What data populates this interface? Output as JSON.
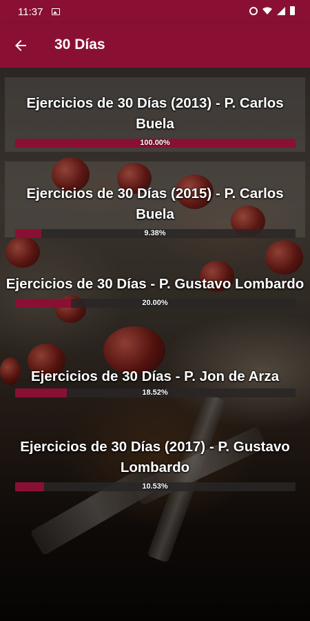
{
  "status_bar": {
    "time": "11:37"
  },
  "app_bar": {
    "title": "30 Días",
    "back_icon": "arrow-left-icon"
  },
  "items": [
    {
      "title": "Ejercicios de 30 Días (2013) - P. Carlos Buela",
      "progress": 100.0,
      "progress_label": "100.00%"
    },
    {
      "title": "Ejercicios de 30 Días (2015) - P. Carlos Buela",
      "progress": 9.38,
      "progress_label": "9.38%"
    },
    {
      "title": "Ejercicios de 30 Días - P. Gustavo Lombardo",
      "progress": 20.0,
      "progress_label": "20.00%"
    },
    {
      "title": "Ejercicios de 30 Días - P. Jon de Arza",
      "progress": 18.52,
      "progress_label": "18.52%"
    },
    {
      "title": "Ejercicios de 30 Días (2017) - P. Gustavo Lombardo",
      "progress": 10.53,
      "progress_label": "10.53%"
    }
  ],
  "colors": {
    "primary": "#8a1033",
    "progress_track": "#282626"
  }
}
